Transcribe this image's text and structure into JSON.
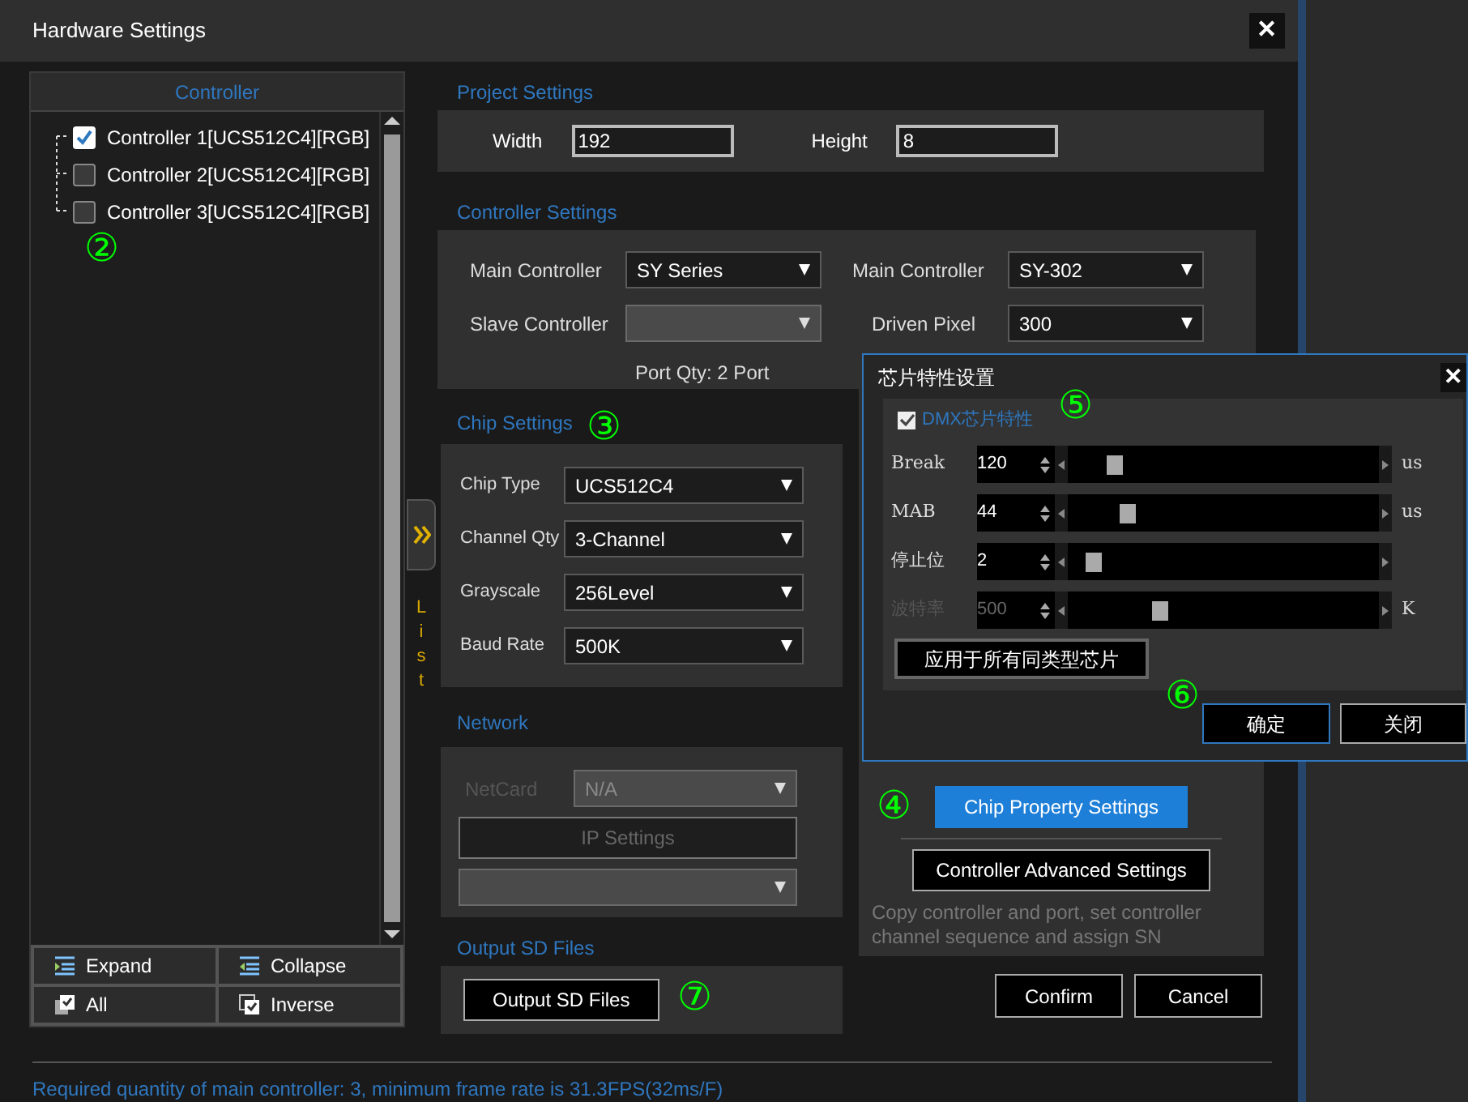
{
  "window": {
    "title": "Hardware Settings",
    "close": "✕"
  },
  "controller_panel": {
    "header": "Controller",
    "annotation": "②",
    "items": [
      {
        "label": "Controller 1[UCS512C4][RGB]",
        "checked": true
      },
      {
        "label": "Controller 2[UCS512C4][RGB]",
        "checked": false
      },
      {
        "label": "Controller 3[UCS512C4][RGB]",
        "checked": false
      }
    ],
    "buttons": [
      {
        "label": "Expand",
        "kind": "expand"
      },
      {
        "label": "Collapse",
        "kind": "collapse"
      },
      {
        "label": "All",
        "kind": "all"
      },
      {
        "label": "Inverse",
        "kind": "inverse"
      }
    ]
  },
  "list_toggle": {
    "label": "List"
  },
  "project_settings": {
    "title": "Project Settings",
    "fields": [
      {
        "label": "Width",
        "value": "192"
      },
      {
        "label": "Height",
        "value": "8"
      }
    ]
  },
  "controller_settings": {
    "title": "Controller Settings",
    "fields": [
      {
        "label": "Main Controller",
        "value": "SY Series"
      },
      {
        "label": "Main Controller",
        "value": "SY-302"
      },
      {
        "label": "Slave Controller"
      },
      {
        "label": "Driven Pixel",
        "value": "300"
      }
    ],
    "port_qty": "Port Qty: 2 Port"
  },
  "chip_settings": {
    "title": "Chip Settings",
    "annotation": "③",
    "fields": [
      {
        "label": "Chip Type",
        "value": "UCS512C4"
      },
      {
        "label": "Channel Qty",
        "value": "3-Channel"
      },
      {
        "label": "Grayscale",
        "value": "256Level"
      },
      {
        "label": "Baud Rate",
        "value": "500K"
      }
    ]
  },
  "network": {
    "title": "Network",
    "disabled": true,
    "netcard": {
      "label": "NetCard",
      "value": "N/A"
    },
    "ip_button": "IP Settings"
  },
  "output_sd": {
    "title": "Output SD Files",
    "button": "Output SD Files",
    "annotation": "⑦"
  },
  "advanced": {
    "annotation": "④",
    "chip_property_button": {
      "label": "Chip Property Settings",
      "highlighted": true
    },
    "advanced_button": "Controller Advanced Settings",
    "description": "Copy controller and port, set controller channel sequence and assign SN"
  },
  "buttons": [
    "Confirm",
    "Cancel"
  ],
  "status_bar": "Required quantity of main controller: 3, minimum frame rate is 31.3FPS(32ms/F)",
  "chip_dialog": {
    "title": "芯片特性设置",
    "close": "✕",
    "annotation": "⑤",
    "dmx": {
      "label": "DMX芯片特性",
      "checked": true
    },
    "params": [
      {
        "label": "Break",
        "value": "120",
        "unit": "us",
        "level": 0.13,
        "disabled": false
      },
      {
        "label": "MAB",
        "value": "44",
        "unit": "us",
        "level": 0.17,
        "disabled": false
      },
      {
        "label": "停止位",
        "value": "2",
        "level": 0.06,
        "disabled": false
      },
      {
        "label": "波特率",
        "value": "500",
        "unit": "K",
        "level": 0.28,
        "disabled": true
      }
    ],
    "apply_button": "应用于所有同类型芯片",
    "annotation_2": "⑥",
    "buttons": [
      {
        "label": "确定",
        "selected": true
      },
      {
        "label": "关闭",
        "selected": false
      }
    ]
  }
}
